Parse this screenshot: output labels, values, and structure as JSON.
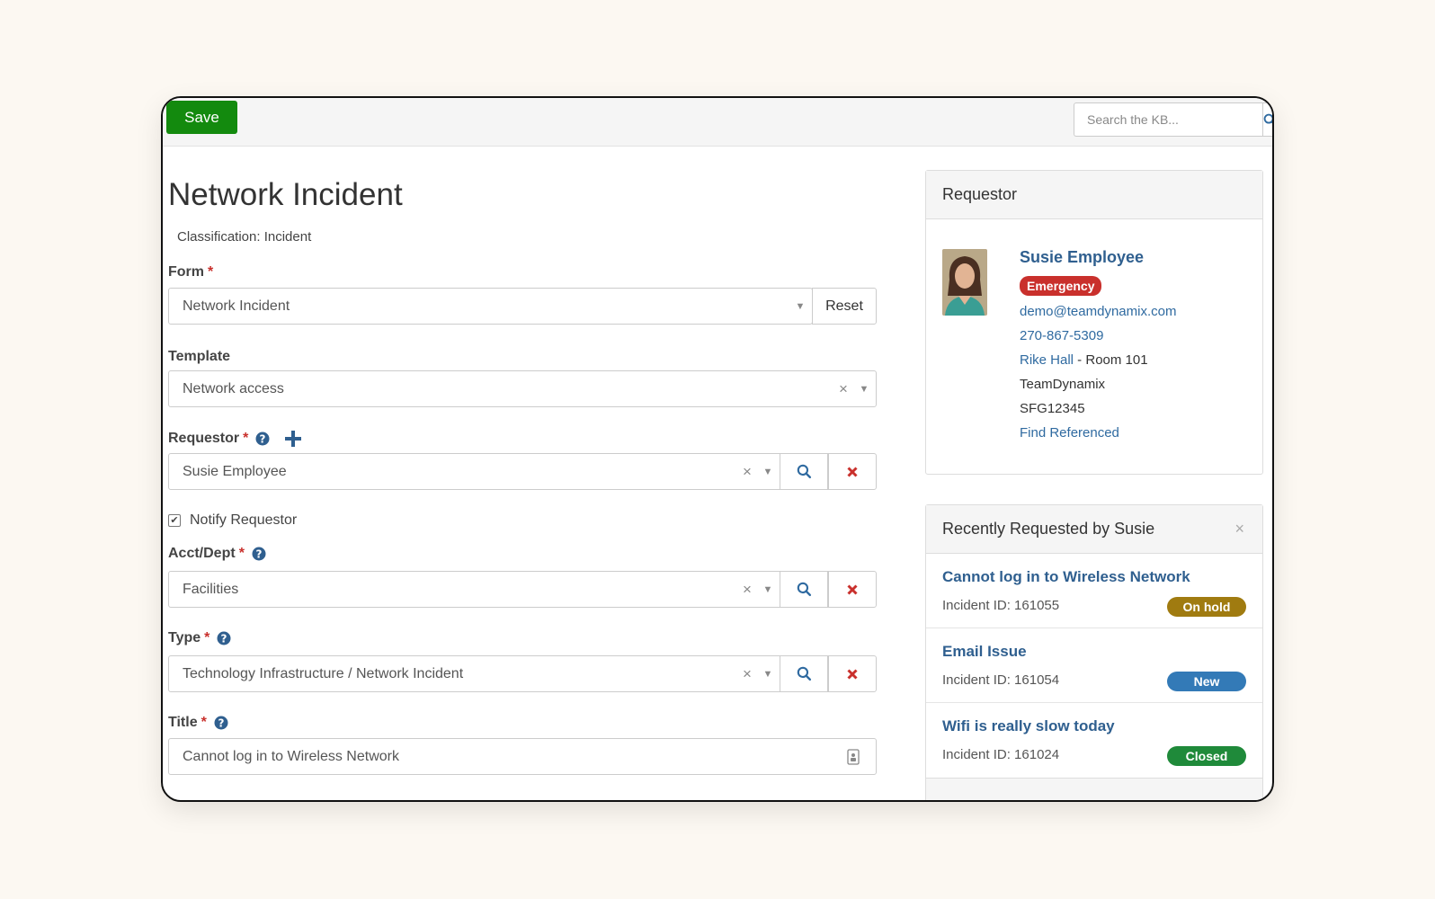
{
  "toolbar": {
    "save_label": "Save",
    "search_placeholder": "Search the KB..."
  },
  "form": {
    "title": "Network Incident",
    "classification": "Classification: Incident",
    "fields": {
      "form": {
        "label": "Form",
        "value": "Network Incident",
        "reset_label": "Reset"
      },
      "template": {
        "label": "Template",
        "value": "Network access"
      },
      "requestor": {
        "label": "Requestor",
        "value": "Susie Employee",
        "notify_label": "Notify Requestor",
        "notify_checked": true
      },
      "acct_dept": {
        "label": "Acct/Dept",
        "value": "Facilities"
      },
      "type": {
        "label": "Type",
        "value": "Technology Infrastructure / Network Incident"
      },
      "title": {
        "label": "Title",
        "value": "Cannot log in to Wireless Network"
      }
    },
    "required_mark": "*"
  },
  "requestor_panel": {
    "heading": "Requestor",
    "name": "Susie Employee",
    "priority_badge": "Emergency",
    "email": "demo@teamdynamix.com",
    "phone": "270-867-5309",
    "building": "Rike Hall",
    "room": "Room 101",
    "organization": "TeamDynamix",
    "code": "SFG12345",
    "find_link": "Find Referenced"
  },
  "recent_panel": {
    "heading": "Recently Requested by Susie",
    "items": [
      {
        "title": "Cannot log in to Wireless Network",
        "id_text": "Incident ID: 161055",
        "status": "On hold",
        "status_color": "#a07b10"
      },
      {
        "title": "Email Issue",
        "id_text": "Incident ID: 161054",
        "status": "New",
        "status_color": "#337ab7"
      },
      {
        "title": "Wifi is really slow today",
        "id_text": "Incident ID: 161024",
        "status": "Closed",
        "status_color": "#1f8a3a"
      }
    ]
  },
  "colors": {
    "save_green": "#138a0e",
    "link_blue": "#2f6aa0",
    "danger_red": "#c9302c"
  }
}
